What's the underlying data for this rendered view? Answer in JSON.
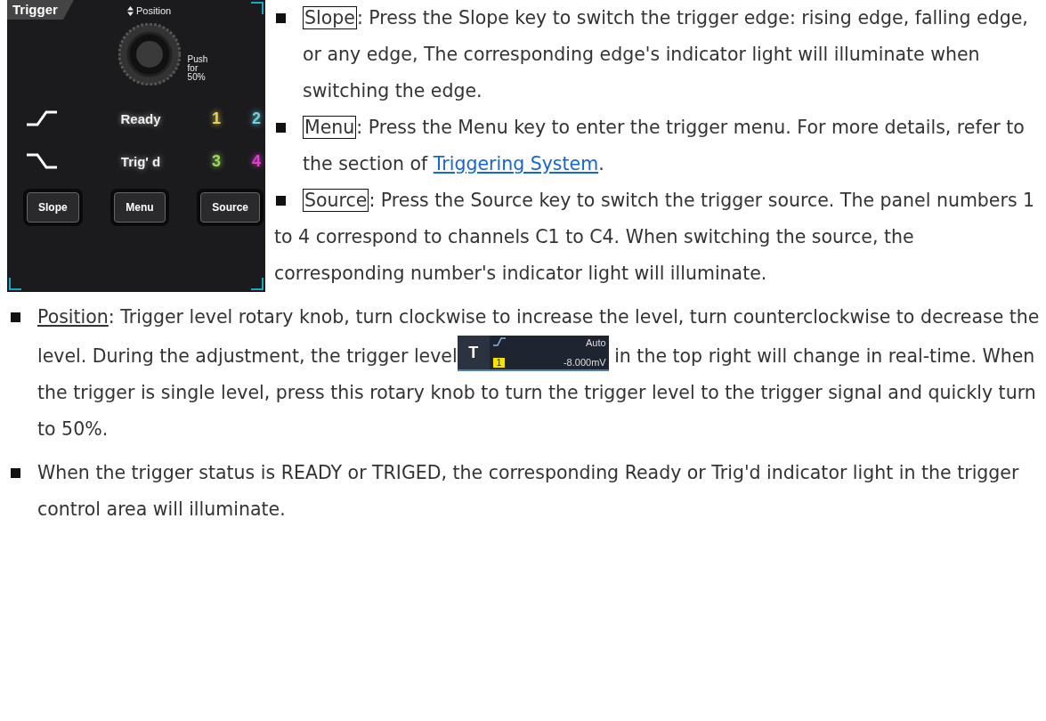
{
  "panel": {
    "title": "Trigger",
    "knob_label": "Position",
    "push_label": [
      "Push",
      "for",
      "50%"
    ],
    "slopes": [
      {
        "kind": "rising"
      },
      {
        "kind": "falling"
      }
    ],
    "status": [
      "Ready",
      "Trig' d"
    ],
    "channels": [
      {
        "label": "1",
        "color": "#e6d35c"
      },
      {
        "label": "2",
        "color": "#6fd3df"
      },
      {
        "label": "3",
        "color": "#9ad95a"
      },
      {
        "label": "4",
        "color": "#e23fd2"
      }
    ],
    "buttons": [
      "Slope",
      "Menu",
      "Source"
    ]
  },
  "items": [
    {
      "parts": [
        {
          "kind": "boxed",
          "text": "Slope"
        },
        {
          "kind": "text",
          "text": ": Press the Slope key to switch the trigger edge: rising edge, falling edge, or any edge, The corresponding edge's indicator light will illuminate when switching the edge."
        }
      ]
    },
    {
      "parts": [
        {
          "kind": "boxed",
          "text": "Menu"
        },
        {
          "kind": "text",
          "text": ": Press the Menu key to enter the trigger menu. For more details, refer to the section of "
        },
        {
          "kind": "link",
          "text": "Triggering System"
        },
        {
          "kind": "text",
          "text": "."
        }
      ]
    },
    {
      "parts": [
        {
          "kind": "boxed",
          "text": "Source"
        },
        {
          "kind": "text",
          "text": ": Press the Source key to switch the trigger source. The panel numbers 1 to 4 correspond to channels C1 to C4. When switching the source, the corresponding number's indicator light will illuminate."
        }
      ]
    },
    {
      "parts": [
        {
          "kind": "underlined",
          "text": "Position"
        },
        {
          "kind": "text",
          "text": ": Trigger level rotary knob, turn clockwise to increase the level, turn counterclockwise to decrease the level. During the adjustment, the trigger level"
        },
        {
          "kind": "widget",
          "label": "T",
          "mode": "Auto",
          "source": "1",
          "level": "-8.000mV"
        },
        {
          "kind": "text",
          "text": " in the top right will change in real-time. When the trigger is single level, press this rotary knob to turn the trigger level to the trigger signal and quickly turn to 50%."
        }
      ]
    },
    {
      "parts": [
        {
          "kind": "text",
          "text": " When the trigger status is READY or TRIGED, the corresponding Ready or Trig'd indicator light in the trigger control area will illuminate."
        }
      ]
    }
  ]
}
